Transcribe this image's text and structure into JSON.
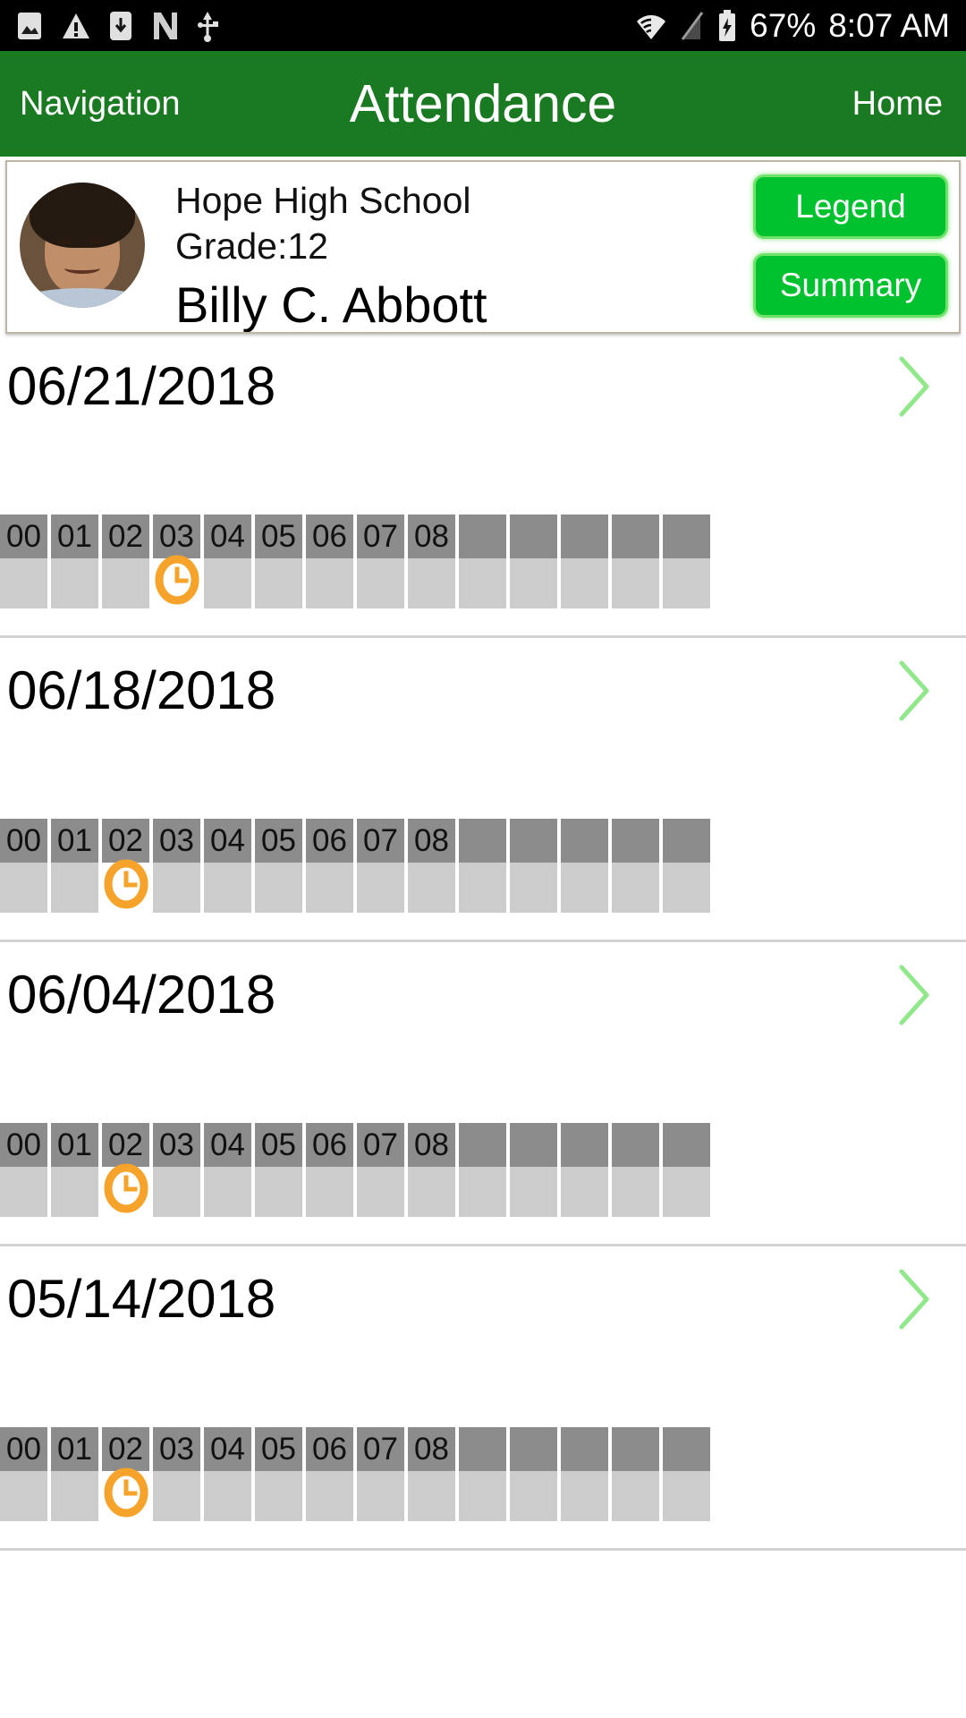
{
  "status_bar": {
    "icons_left": [
      "image-icon",
      "warning-icon",
      "download-icon",
      "nfc-icon",
      "usb-icon"
    ],
    "icons_right": [
      "wifi-icon",
      "signal-off-icon",
      "battery-charging-icon"
    ],
    "battery_percent": "67%",
    "time": "8:07 AM"
  },
  "app_bar": {
    "nav_label": "Navigation",
    "title": "Attendance",
    "home_label": "Home"
  },
  "student_card": {
    "avatar": "student-photo",
    "school": "Hope High School",
    "grade": "Grade:12",
    "name": "Billy C. Abbott",
    "legend_label": "Legend",
    "summary_label": "Summary"
  },
  "colors": {
    "app_bar_green": "#1a7a22",
    "button_green": "#00c22e",
    "button_border_green": "#6ee36a",
    "chevron_green": "#90e88a",
    "period_header_gray": "#8c8c8c",
    "period_cell_gray": "#cccccc",
    "clock_orange": "#f5a32a"
  },
  "period_labels": [
    "00",
    "01",
    "02",
    "03",
    "04",
    "05",
    "06",
    "07",
    "08",
    "",
    "",
    "",
    "",
    ""
  ],
  "days": [
    {
      "date": "06/21/2018",
      "chevron": "chevron-right-icon",
      "periods": [
        "00",
        "01",
        "02",
        "03",
        "04",
        "05",
        "06",
        "07",
        "08",
        "",
        "",
        "",
        "",
        ""
      ],
      "marks": [
        null,
        null,
        null,
        "tardy-clock-icon",
        null,
        null,
        null,
        null,
        null,
        null,
        null,
        null,
        null,
        null
      ]
    },
    {
      "date": "06/18/2018",
      "chevron": "chevron-right-icon",
      "periods": [
        "00",
        "01",
        "02",
        "03",
        "04",
        "05",
        "06",
        "07",
        "08",
        "",
        "",
        "",
        "",
        ""
      ],
      "marks": [
        null,
        null,
        "tardy-clock-icon",
        null,
        null,
        null,
        null,
        null,
        null,
        null,
        null,
        null,
        null,
        null
      ]
    },
    {
      "date": "06/04/2018",
      "chevron": "chevron-right-icon",
      "periods": [
        "00",
        "01",
        "02",
        "03",
        "04",
        "05",
        "06",
        "07",
        "08",
        "",
        "",
        "",
        "",
        ""
      ],
      "marks": [
        null,
        null,
        "tardy-clock-icon",
        null,
        null,
        null,
        null,
        null,
        null,
        null,
        null,
        null,
        null,
        null
      ]
    },
    {
      "date": "05/14/2018",
      "chevron": "chevron-right-icon",
      "periods": [
        "00",
        "01",
        "02",
        "03",
        "04",
        "05",
        "06",
        "07",
        "08",
        "",
        "",
        "",
        "",
        ""
      ],
      "marks": [
        null,
        null,
        "tardy-clock-icon",
        null,
        null,
        null,
        null,
        null,
        null,
        null,
        null,
        null,
        null,
        null
      ]
    }
  ]
}
